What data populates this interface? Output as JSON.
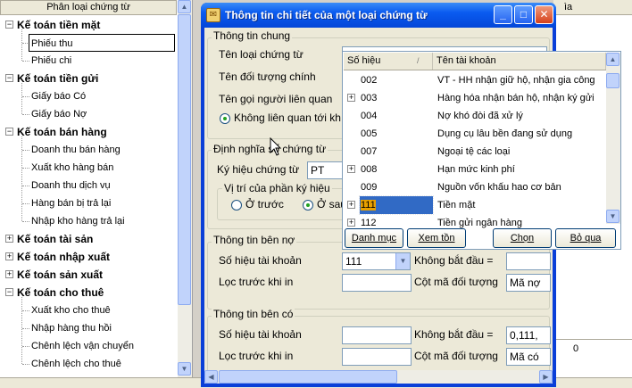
{
  "tree": {
    "header": "Phân loại chứng từ",
    "groups": [
      {
        "label": "Kế toán tiền mặt",
        "expanded": true,
        "items": [
          "Phiếu thu",
          "Phiếu chi"
        ]
      },
      {
        "label": "Kế toán tiền gửi",
        "expanded": true,
        "items": [
          "Giấy báo Có",
          "Giấy báo Nợ"
        ]
      },
      {
        "label": "Kế toán bán hàng",
        "expanded": true,
        "items": [
          "Doanh thu bán hàng",
          "Xuất kho hàng bán",
          "Doanh thu dịch vụ",
          "Hàng bán bị trả lại",
          "Nhập kho hàng trả lại"
        ]
      },
      {
        "label": "Kế toán tài sản",
        "expanded": false,
        "items": []
      },
      {
        "label": "Kế toán nhập xuất",
        "expanded": false,
        "items": []
      },
      {
        "label": "Kế toán sản xuất",
        "expanded": false,
        "items": []
      },
      {
        "label": "Kế toán cho thuê",
        "expanded": true,
        "items": [
          "Xuất kho cho thuê",
          "Nhập hàng thu hồi",
          "Chênh lệch vận chuyển",
          "Chênh lệch cho thuê"
        ]
      }
    ]
  },
  "background": {
    "grid_header": "ìa",
    "grid_footer_value": "0"
  },
  "dialog": {
    "title": "Thông tin chi tiết của một loại chứng từ",
    "general": {
      "title": "Thông tin chung",
      "voucher_type_label": "Tên loại chứng từ",
      "main_object_label": "Tên đối tượng chính",
      "contact_label": "Tên gọi người liên quan",
      "no_relation_label": "Không liên quan tới kh"
    },
    "numbering": {
      "title": "Định nghĩa số chứng từ",
      "symbol_label": "Ký hiệu chứng từ",
      "symbol_value": "PT",
      "position_title": "Vị trí của phần ký hiệu",
      "before_label": "Ở trước",
      "after_label": "Ở sau"
    },
    "debit": {
      "title": "Thông tin bên nợ",
      "account_label": "Số hiệu tài khoản",
      "account_value": "111",
      "not_start_label": "Không bắt đầu =",
      "filter_label": "Lọc trước khi in",
      "object_col_label": "Cột mã đối tượng",
      "object_col_value": "Mã nợ"
    },
    "credit": {
      "title": "Thông tin bên có",
      "account_label": "Số hiệu tài khoản",
      "not_start_label": "Không bắt đầu =",
      "not_start_value": "0,111,",
      "filter_label": "Lọc trước khi in",
      "object_col_label": "Cột mã đối tượng",
      "object_col_value": "Mã có"
    }
  },
  "account_dropdown": {
    "col_code": "Số hiệu",
    "col_name": "Tên tài khoản",
    "rows": [
      {
        "code": "002",
        "name": "VT - HH nhận giữ hộ, nhận gia công",
        "expander": false
      },
      {
        "code": "003",
        "name": "Hàng hóa nhận bán hộ, nhận ký gửi",
        "expander": true
      },
      {
        "code": "004",
        "name": "Nợ khó đòi đã xử lý",
        "expander": false
      },
      {
        "code": "005",
        "name": "Dụng cụ lâu bền đang sử dụng",
        "expander": false
      },
      {
        "code": "007",
        "name": "Ngoại tệ các loại",
        "expander": false
      },
      {
        "code": "008",
        "name": "Hạn mức kinh phí",
        "expander": true
      },
      {
        "code": "009",
        "name": "Nguồn vốn khấu hao cơ bản",
        "expander": false
      },
      {
        "code": "111",
        "name": "Tiền mặt",
        "expander": true,
        "selected": true
      },
      {
        "code": "112",
        "name": "Tiền gửi ngân hàng",
        "expander": true
      }
    ],
    "buttons": {
      "catalog": "Danh mục",
      "view_balance": "Xem tồn",
      "choose": "Chọn",
      "skip": "Bỏ qua"
    }
  }
}
